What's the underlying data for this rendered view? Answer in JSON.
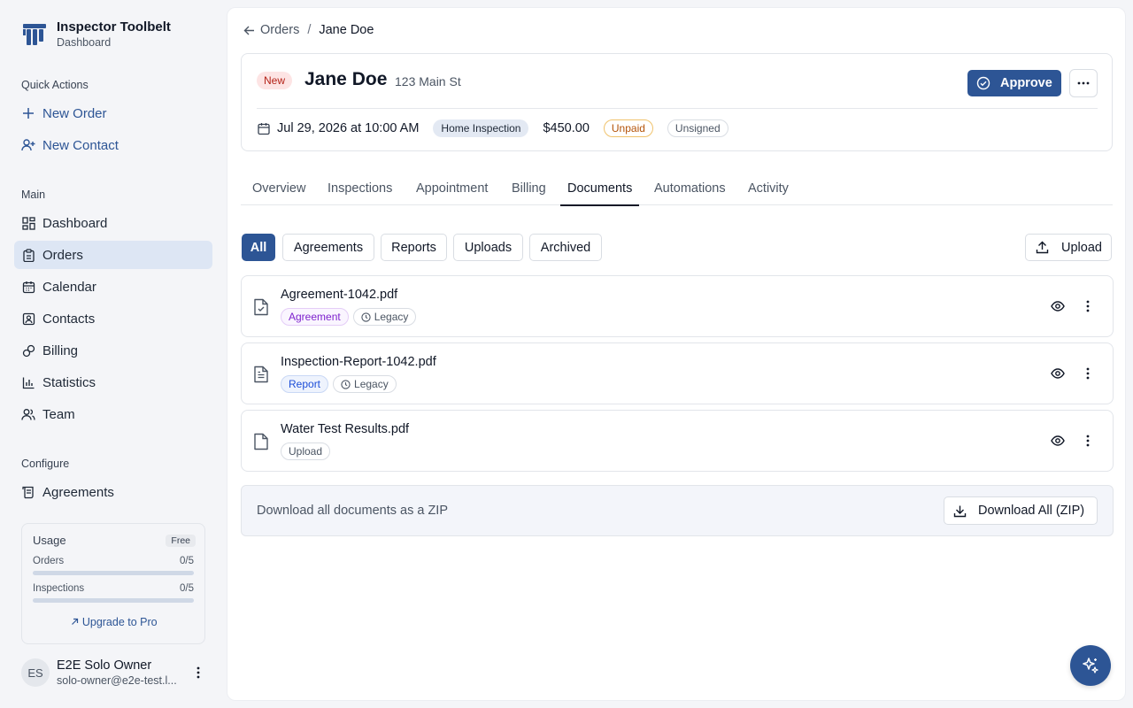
{
  "brand": {
    "title": "Inspector Toolbelt",
    "subtitle": "Dashboard"
  },
  "quick_actions": {
    "label": "Quick Actions",
    "items": [
      {
        "label": "New Order",
        "icon": "plus-icon"
      },
      {
        "label": "New Contact",
        "icon": "user-plus-icon"
      }
    ]
  },
  "main_nav": {
    "label": "Main",
    "items": [
      {
        "label": "Dashboard",
        "icon": "dashboard-icon"
      },
      {
        "label": "Orders",
        "icon": "clipboard-icon",
        "active": true
      },
      {
        "label": "Calendar",
        "icon": "calendar-icon"
      },
      {
        "label": "Contacts",
        "icon": "contact-card-icon"
      },
      {
        "label": "Billing",
        "icon": "billing-icon"
      },
      {
        "label": "Statistics",
        "icon": "bar-chart-icon"
      },
      {
        "label": "Team",
        "icon": "team-icon"
      }
    ]
  },
  "configure_nav": {
    "label": "Configure",
    "items": [
      {
        "label": "Agreements",
        "icon": "scroll-icon"
      }
    ]
  },
  "usage": {
    "title": "Usage",
    "plan": "Free",
    "orders_label": "Orders",
    "orders_value": "0/5",
    "orders_fraction": 0,
    "inspections_label": "Inspections",
    "inspections_value": "0/5",
    "inspections_fraction": 0,
    "upgrade_label": "Upgrade to Pro"
  },
  "user": {
    "initials": "ES",
    "name": "E2E Solo Owner",
    "email": "solo-owner@e2e-test.l..."
  },
  "breadcrumb": {
    "parent": "Orders",
    "separator": "/",
    "current": "Jane Doe"
  },
  "order": {
    "status_badge": "New",
    "customer_name": "Jane Doe",
    "address": "123 Main St",
    "approve_label": "Approve",
    "date": "Jul 29, 2026 at 10:00 AM",
    "service_type": "Home Inspection",
    "price": "$450.00",
    "payment_status": "Unpaid",
    "signature_status": "Unsigned"
  },
  "tabs": [
    "Overview",
    "Inspections",
    "Appointment",
    "Billing",
    "Documents",
    "Automations",
    "Activity"
  ],
  "active_tab": "Documents",
  "filters": [
    "All",
    "Agreements",
    "Reports",
    "Uploads",
    "Archived"
  ],
  "active_filter": "All",
  "upload_label": "Upload",
  "documents": [
    {
      "name": "Agreement-1042.pdf",
      "tag": "Agreement",
      "legacy": "Legacy",
      "icon": "file-check-icon"
    },
    {
      "name": "Inspection-Report-1042.pdf",
      "tag": "Report",
      "legacy": "Legacy",
      "icon": "file-text-icon"
    },
    {
      "name": "Water Test Results.pdf",
      "tag": "Upload",
      "legacy": null,
      "icon": "file-icon"
    }
  ],
  "zip": {
    "text": "Download all documents as a ZIP",
    "button": "Download All (ZIP)"
  },
  "colors": {
    "accent": "#2d5595",
    "active_nav_bg": "#dde6f4",
    "new_badge": "#b42318",
    "unpaid": "#b45309"
  }
}
